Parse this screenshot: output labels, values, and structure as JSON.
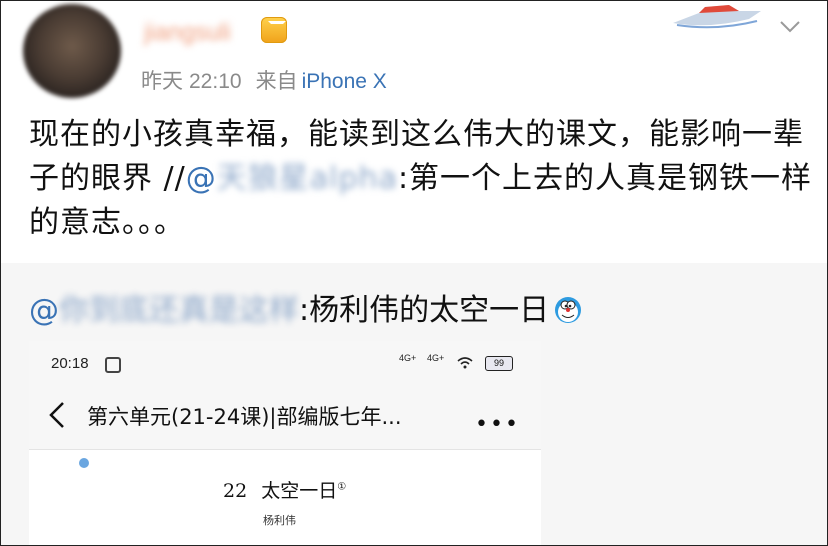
{
  "post": {
    "author_name": "jiangsuli",
    "time_label": "昨天",
    "time": "22:10",
    "source_label": "来自",
    "device": "iPhone X",
    "text_main": "现在的小孩真幸福，能读到这么伟大的课文，能影响一辈子的眼界 //",
    "mention_prefix": "@",
    "mention_name": "天狼星alpha",
    "text_tail": ":第一个上去的人真是钢铁一样的意志。。。"
  },
  "repost": {
    "mention_prefix": "@",
    "mention_name": "你到底还真是这样",
    "text": ":杨利伟的太空一日",
    "emoji_icon": "doraemon-emoji-icon"
  },
  "screenshot": {
    "status_time": "20:18",
    "signal_1": "4G+",
    "signal_2": "4G+",
    "battery": "99",
    "nav_title": "第六单元(21-24课)|部编版七年...",
    "more": "•••",
    "lesson_number": "22",
    "lesson_title": "太空一日",
    "lesson_sup": "①",
    "lesson_author": "杨利伟"
  },
  "colors": {
    "link": "#3a73b5",
    "meta": "#8a8a8a",
    "repost_bg": "#f6f6f6"
  }
}
